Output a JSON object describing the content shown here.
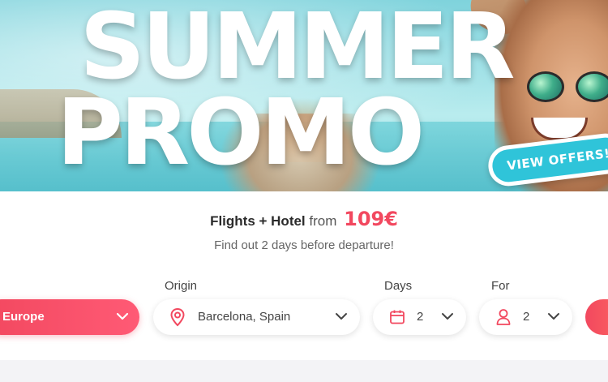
{
  "hero": {
    "title_line1": "SUMMER",
    "title_line2": "PROMO",
    "cta_label": "VIEW OFFERS!"
  },
  "offer": {
    "product": "Flights + Hotel",
    "from_label": "from",
    "price": "109€",
    "subtitle": "Find out 2 days before departure!"
  },
  "search": {
    "region_value": "Europe",
    "origin_label": "Origin",
    "origin_value": "Barcelona, Spain",
    "days_label": "Days",
    "days_value": "2",
    "for_label": "For",
    "for_value": "2"
  },
  "icons": {
    "origin": "map-pin-icon",
    "days": "calendar-icon",
    "for": "person-icon",
    "dropdown": "chevron-down-icon"
  },
  "colors": {
    "accent": "#f2485f",
    "cta": "#2fc4d9",
    "text": "#444444"
  }
}
